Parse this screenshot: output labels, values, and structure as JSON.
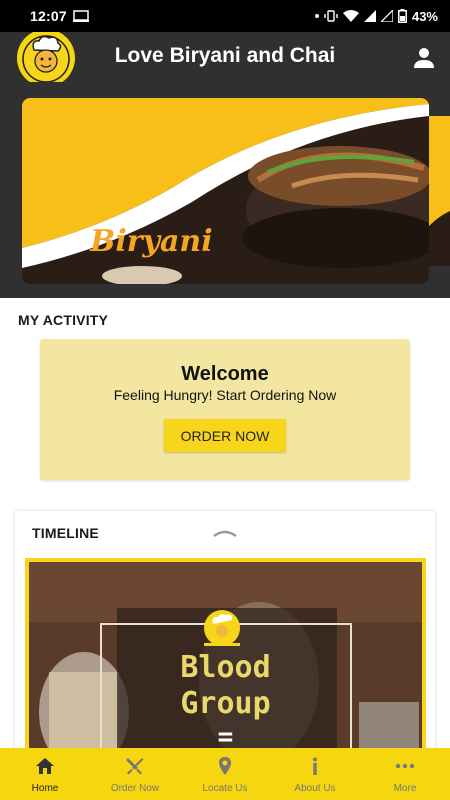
{
  "status_bar": {
    "time": "12:07",
    "battery": "43%"
  },
  "app": {
    "title": "Love Biryani and Chai"
  },
  "banner": {
    "label": "Biryani"
  },
  "activity": {
    "section_title": "MY ACTIVITY",
    "welcome_title": "Welcome",
    "welcome_subtitle": "Feeling Hungry! Start Ordering Now",
    "order_button": "ORDER NOW"
  },
  "timeline": {
    "title": "TIMELINE",
    "poster_line1": "Blood",
    "poster_line2": "Group",
    "poster_line3": "="
  },
  "bottom_nav": {
    "items": [
      {
        "label": "Home",
        "icon": "home-icon",
        "active": true
      },
      {
        "label": "Order Now",
        "icon": "fork-knife-icon",
        "active": false
      },
      {
        "label": "Locate Us",
        "icon": "location-pin-icon",
        "active": false
      },
      {
        "label": "About Us",
        "icon": "info-icon",
        "active": false
      },
      {
        "label": "More",
        "icon": "more-dots-icon",
        "active": false
      }
    ]
  },
  "colors": {
    "accent_yellow": "#f5d60f",
    "header_dark": "#303030",
    "card_cream": "#f2e6a0"
  }
}
